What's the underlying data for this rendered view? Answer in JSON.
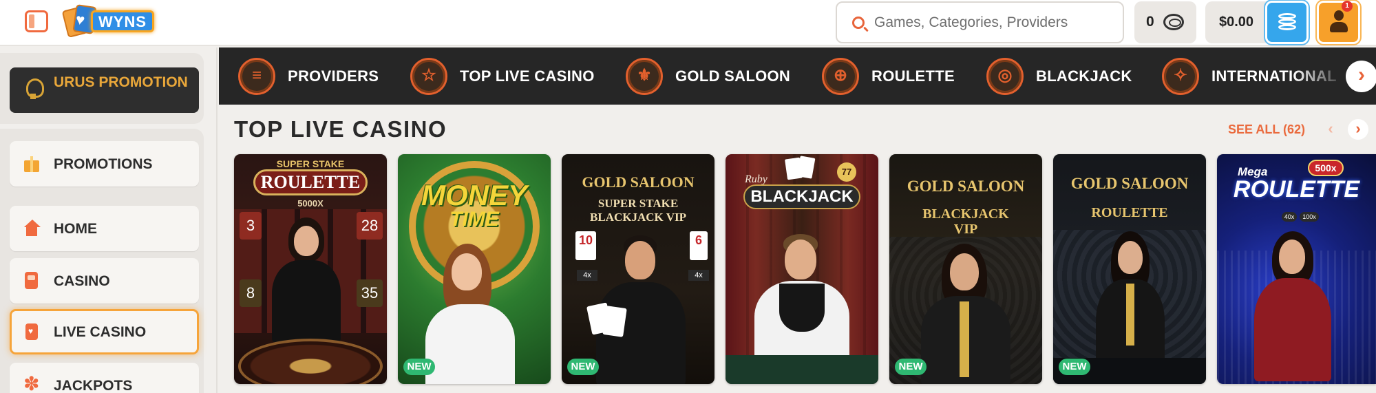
{
  "header": {
    "logo_text": "WYNS",
    "search": {
      "placeholder": "Games, Categories, Providers"
    },
    "coins": "0",
    "balance": "$0.00",
    "notification_count": "1"
  },
  "sidebar": {
    "promo": "URUS PROMOTION",
    "promotions": "PROMOTIONS",
    "items": [
      {
        "label": "HOME",
        "icon": "home-icon"
      },
      {
        "label": "CASINO",
        "icon": "slot-machine-icon"
      },
      {
        "label": "LIVE CASINO",
        "icon": "cards-icon",
        "active": true
      },
      {
        "label": "JACKPOTS",
        "icon": "jackpot-icon"
      }
    ]
  },
  "categories": [
    {
      "label": "PROVIDERS",
      "icon": "document-icon"
    },
    {
      "label": "TOP LIVE CASINO",
      "icon": "star-icon"
    },
    {
      "label": "GOLD SALOON",
      "icon": "fleur-de-lis-icon"
    },
    {
      "label": "ROULETTE",
      "icon": "roulette-icon"
    },
    {
      "label": "BLACKJACK",
      "icon": "chips-icon"
    },
    {
      "label": "INTERNATIONAL",
      "icon": "compass-icon"
    }
  ],
  "section": {
    "title": "TOP LIVE CASINO",
    "see_all": "SEE ALL (62)"
  },
  "games": [
    {
      "title": "ROULETTE",
      "top": "SUPER STAKE",
      "sub": "5000X",
      "new": false,
      "badge_new": "",
      "numbers": [
        "3",
        "28",
        "8",
        "35"
      ]
    },
    {
      "title": "MONEY",
      "title2": "TIME",
      "new": true,
      "badge_new": "NEW"
    },
    {
      "title": "GOLD SALOON",
      "sub": "SUPER STAKE BLACKJACK VIP",
      "new": true,
      "badge_new": "NEW",
      "cards": [
        "10",
        "6",
        "4x",
        "4x"
      ]
    },
    {
      "title": "BLACKJACK",
      "top": "Ruby",
      "badge": "77",
      "new": false,
      "badge_new": ""
    },
    {
      "title": "GOLD SALOON",
      "sub": "BLACKJACK VIP",
      "new": true,
      "badge_new": "NEW"
    },
    {
      "title": "GOLD SALOON",
      "sub": "ROULETTE",
      "new": true,
      "badge_new": "NEW"
    },
    {
      "title": "ROULETTE",
      "top": "Mega",
      "badge": "500x",
      "small": [
        "40x",
        "100x"
      ],
      "new": false,
      "badge_new": ""
    }
  ],
  "colors": {
    "accent": "#ea6a3d",
    "category_bar": "#262626",
    "new_badge": "#2fb872",
    "wallet": "#35a6ec",
    "profile": "#f7a02a"
  }
}
